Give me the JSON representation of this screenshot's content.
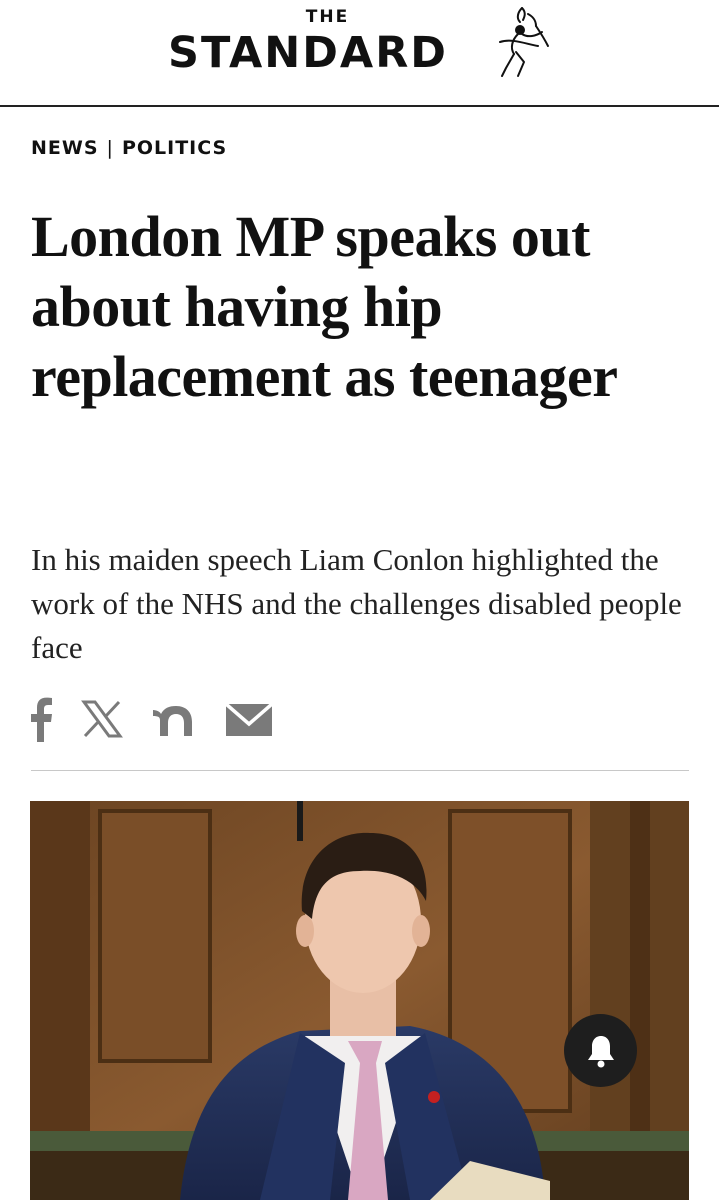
{
  "masthead": {
    "the": "THE",
    "name": "STANDARD",
    "logo_icon": "eros-statue-icon"
  },
  "breadcrumb": {
    "section": "NEWS",
    "separator": "|",
    "subsection": "POLITICS"
  },
  "article": {
    "headline": "London MP speaks out about having hip replacement as teenager",
    "standfirst": "In his maiden speech Liam Conlon highlighted the work of the NHS and the challenges disabled people face"
  },
  "share": {
    "icons": [
      "facebook-icon",
      "x-icon",
      "nextdoor-icon",
      "email-icon"
    ],
    "icon_color": "#7a7a7a"
  },
  "hero_image": {
    "description_icon": "photo-of-mp-in-commons",
    "notification_icon": "bell-icon"
  },
  "colors": {
    "text": "#111111",
    "divider": "#c8c8c8",
    "bell_bg": "#1e1e1e"
  }
}
